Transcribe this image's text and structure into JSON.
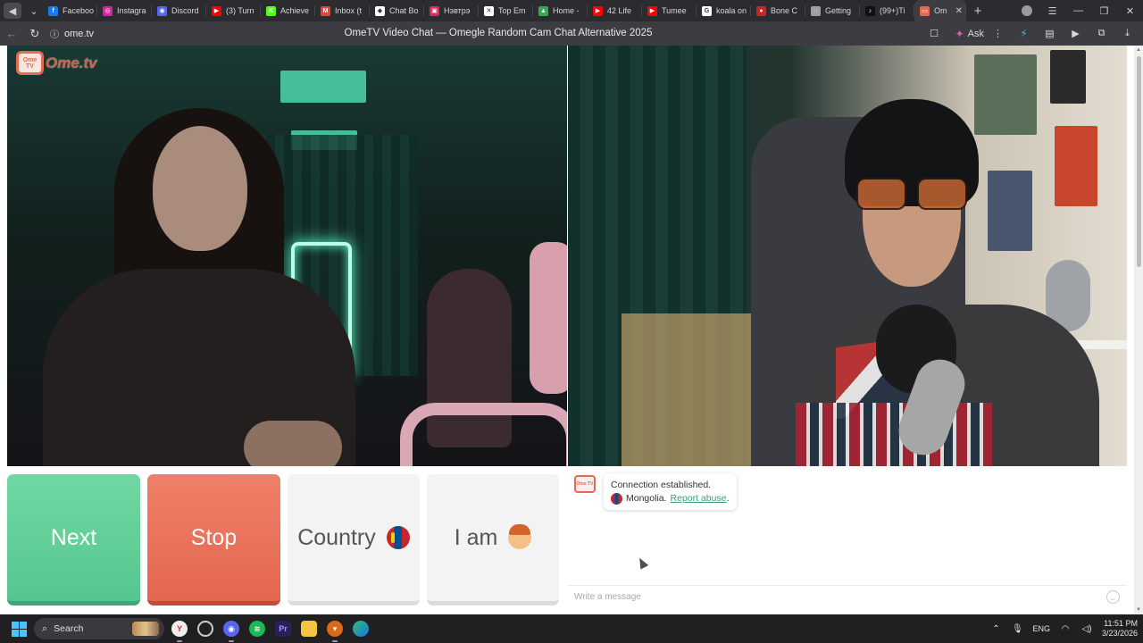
{
  "browser": {
    "tabs": [
      {
        "label": "Faceboo",
        "icon": "facebook-icon",
        "color": "#1877f2",
        "glyph": "f"
      },
      {
        "label": "Instagra",
        "icon": "instagram-icon",
        "color": "#d6249f",
        "glyph": "◎"
      },
      {
        "label": "Discord",
        "icon": "discord-icon",
        "color": "#5865f2",
        "glyph": "◉"
      },
      {
        "label": "(3) Turn",
        "icon": "youtube-icon",
        "color": "#ff0000",
        "glyph": "▶"
      },
      {
        "label": "Achieve",
        "icon": "kick-icon",
        "color": "#53fc18",
        "glyph": "K"
      },
      {
        "label": "Inbox (t",
        "icon": "gmail-icon",
        "color": "#ea4335",
        "glyph": "M"
      },
      {
        "label": "Chat Bo",
        "icon": "chatbot-icon",
        "color": "#ffffff",
        "glyph": "◆"
      },
      {
        "label": "Нэвтрэ",
        "icon": "page-icon",
        "color": "#e0245e",
        "glyph": "▣"
      },
      {
        "label": "Top Em",
        "icon": "tools-icon",
        "color": "#ffffff",
        "glyph": "✕"
      },
      {
        "label": "Home -",
        "icon": "drive-icon",
        "color": "#34a853",
        "glyph": "▲"
      },
      {
        "label": "42 Life",
        "icon": "youtube-icon",
        "color": "#ff0000",
        "glyph": "▶"
      },
      {
        "label": "Tumee",
        "icon": "youtube-icon",
        "color": "#ff0000",
        "glyph": "▶"
      },
      {
        "label": "koala on",
        "icon": "google-icon",
        "color": "#ffffff",
        "glyph": "G"
      },
      {
        "label": "Bone C",
        "icon": "bone-icon",
        "color": "#cc2222",
        "glyph": "●"
      },
      {
        "label": "Getting",
        "icon": "globe-icon",
        "color": "#9aa0a6",
        "glyph": "◌"
      },
      {
        "label": "(99+)Ti",
        "icon": "tiktok-icon",
        "color": "#111111",
        "glyph": "♪"
      },
      {
        "label": "Om",
        "icon": "ometv-icon",
        "color": "#e46a52",
        "glyph": "▭",
        "current": true
      }
    ],
    "url": "ome.tv",
    "title": "OmeTV Video Chat — Omegle Random Cam Chat Alternative 2025",
    "ask_label": "Ask"
  },
  "ometv": {
    "logo_text": "Ome.tv",
    "logo_badge": "Ome TV",
    "buttons": {
      "next": "Next",
      "stop": "Stop",
      "country": "Country",
      "iam": "I am"
    },
    "chat": {
      "status": "Connection established.",
      "country": "Mongolia.",
      "report": "Report abuse",
      "report_suffix": ".",
      "placeholder": "Write a message"
    }
  },
  "taskbar": {
    "search_label": "Search",
    "language": "ENG",
    "time": "11:51 PM",
    "date": "3/23/2026"
  }
}
